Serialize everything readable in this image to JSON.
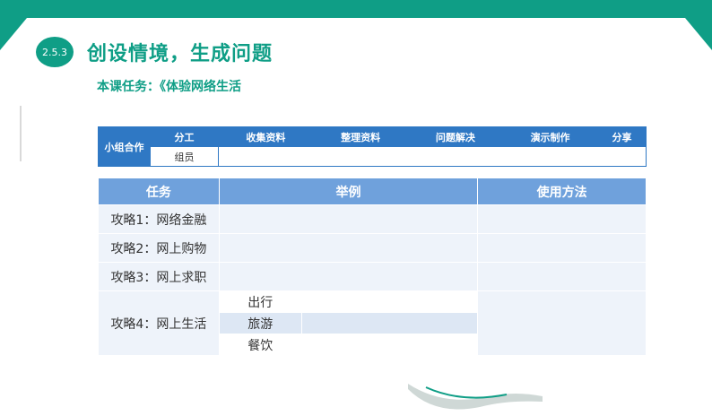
{
  "header": {
    "section_number": "2.5.3",
    "title": "创设情境，生成问题",
    "subtitle": "本课任务：《体验网络生活"
  },
  "group_table": {
    "label": "小组合作",
    "headers": [
      "分工",
      "收集资料",
      "整理资料",
      "问题解决",
      "演示制作",
      "分享"
    ],
    "member_label": "组员"
  },
  "task_table": {
    "headers": [
      "任务",
      "举例",
      "使用方法"
    ],
    "rows": [
      {
        "task": "攻略1：网络金融"
      },
      {
        "task": "攻略2：网上购物"
      },
      {
        "task": "攻略3：网上求职"
      },
      {
        "task": "攻略4：网上生活",
        "subitems": [
          "出行",
          "旅游",
          "餐饮"
        ]
      }
    ]
  },
  "colors": {
    "brand_green": "#0f9e86",
    "table_blue": "#2f78c4",
    "header_light_blue": "#6fa1dc"
  }
}
